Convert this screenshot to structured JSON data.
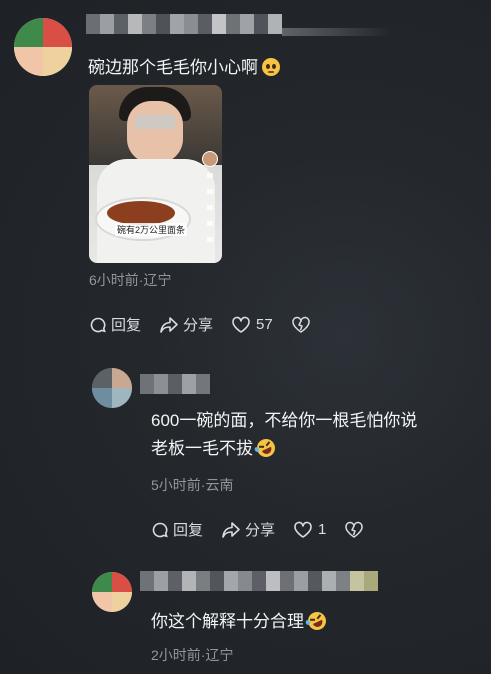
{
  "comments": [
    {
      "text": "碗边那个毛毛你小心啊",
      "emoji": "pleading-face",
      "video_caption": "碗有2万公里面条",
      "meta": "6小时前·辽宁",
      "reply_label": "回复",
      "share_label": "分享",
      "like_count": "57"
    },
    {
      "text_line1": "600一碗的面，不给你一根毛怕你说",
      "text_line2": "老板一毛不拔",
      "emoji": "rolling-laughing-face",
      "meta": "5小时前·云南",
      "reply_label": "回复",
      "share_label": "分享",
      "like_count": "1"
    },
    {
      "text": "你这个解释十分合理",
      "emoji": "rolling-laughing-face",
      "meta": "2小时前·辽宁"
    }
  ],
  "colors": {
    "background": "#24282d",
    "text": "#f2f4f6",
    "meta": "#8f969e",
    "action": "#d8dde2"
  }
}
